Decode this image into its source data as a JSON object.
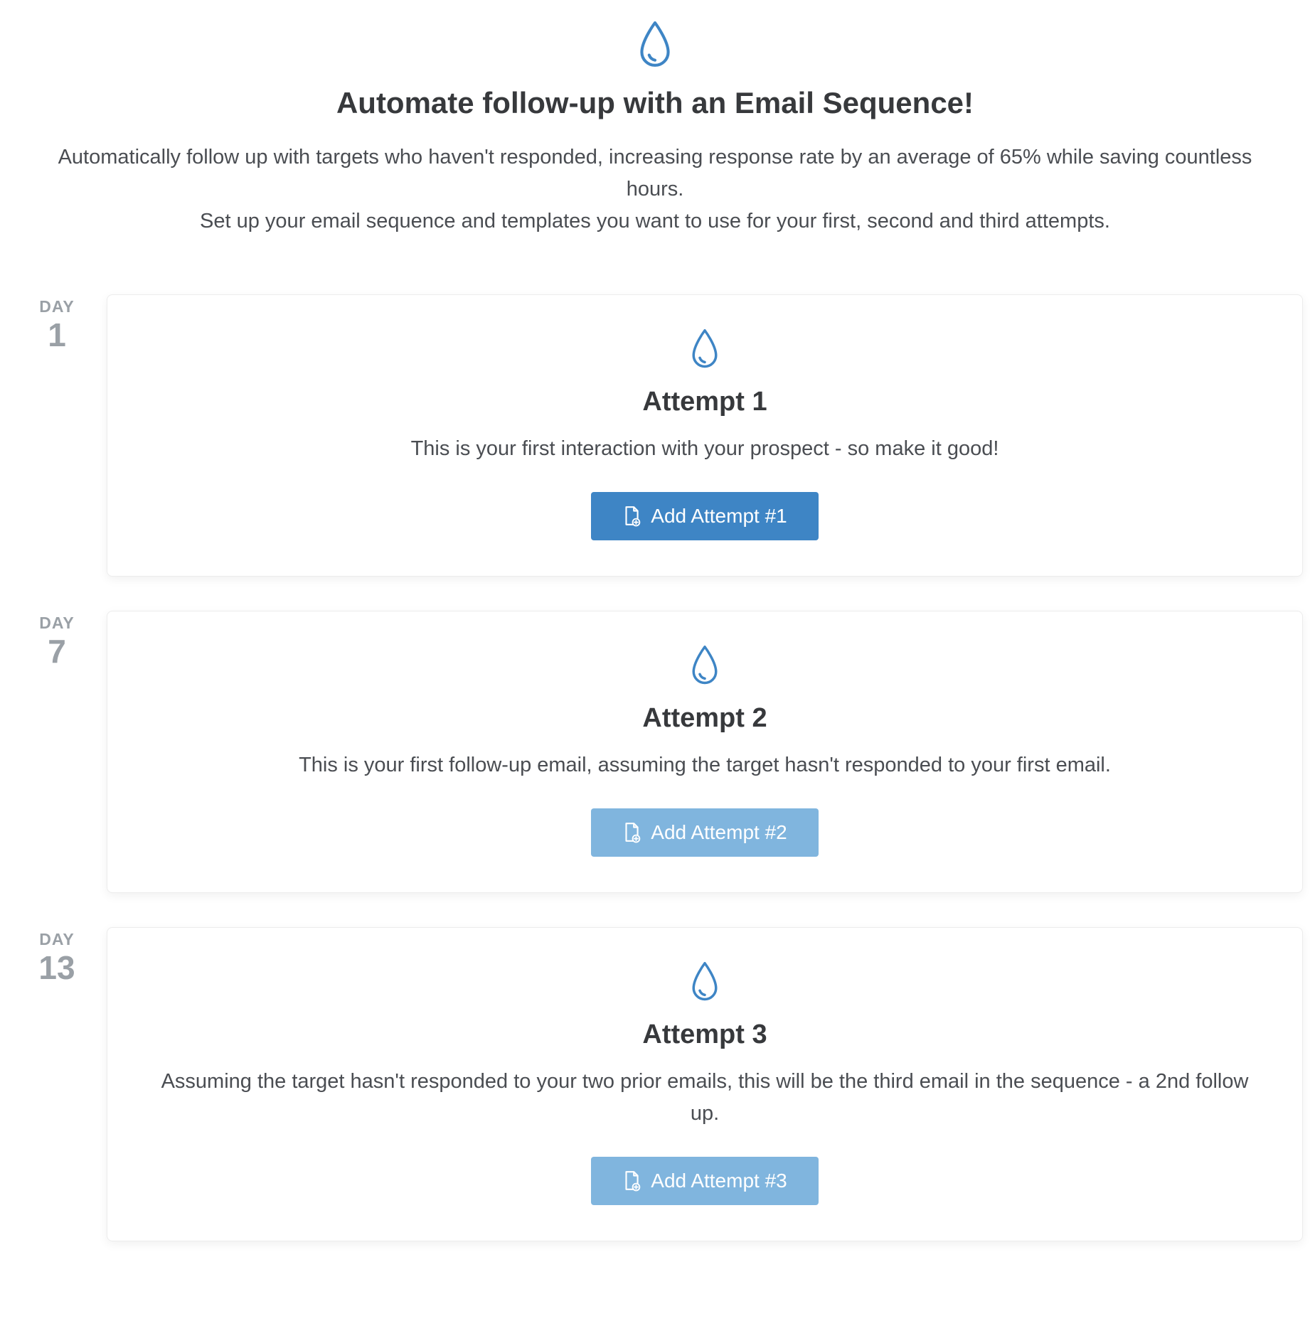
{
  "hero": {
    "title": "Automate follow-up with an Email Sequence!",
    "line1": "Automatically follow up with targets who haven't responded, increasing response rate by an average of 65% while saving countless hours.",
    "line2": "Set up your email sequence and templates you want to use for your first, second and third attempts."
  },
  "day_label": "DAY",
  "steps": [
    {
      "day": "1",
      "title": "Attempt 1",
      "description": "This is your first interaction with your prospect - so make it good!",
      "button_label": "Add Attempt #1",
      "button_primary": true
    },
    {
      "day": "7",
      "title": "Attempt 2",
      "description": "This is your first follow-up email, assuming the target hasn't responded to your first email.",
      "button_label": "Add Attempt #2",
      "button_primary": false
    },
    {
      "day": "13",
      "title": "Attempt 3",
      "description": "Assuming the target hasn't responded to your two prior emails, this will be the third email in the sequence - a 2nd follow up.",
      "button_label": "Add Attempt #3",
      "button_primary": false
    }
  ],
  "colors": {
    "accent": "#3e85c5",
    "accent_muted": "#80b5de",
    "text": "#37393c",
    "subtext": "#4a4d52",
    "grey": "#9aa0a6"
  }
}
